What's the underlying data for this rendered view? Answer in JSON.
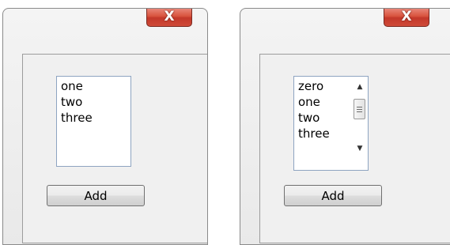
{
  "windows": [
    {
      "close_glyph": "X",
      "list": {
        "items": [
          "one",
          "two",
          "three"
        ]
      },
      "add_label": "Add"
    },
    {
      "close_glyph": "X",
      "list": {
        "items": [
          "zero",
          "one",
          "two",
          "three"
        ],
        "scrollbar": {
          "up_arrow": "▲",
          "down_arrow": "▼",
          "thumb_icon": "grip-icon"
        }
      },
      "add_label": "Add"
    }
  ],
  "colors": {
    "close_button": "#d24b39",
    "listbox_border": "#8ea4c1",
    "client_background": "#f0f0f0"
  }
}
